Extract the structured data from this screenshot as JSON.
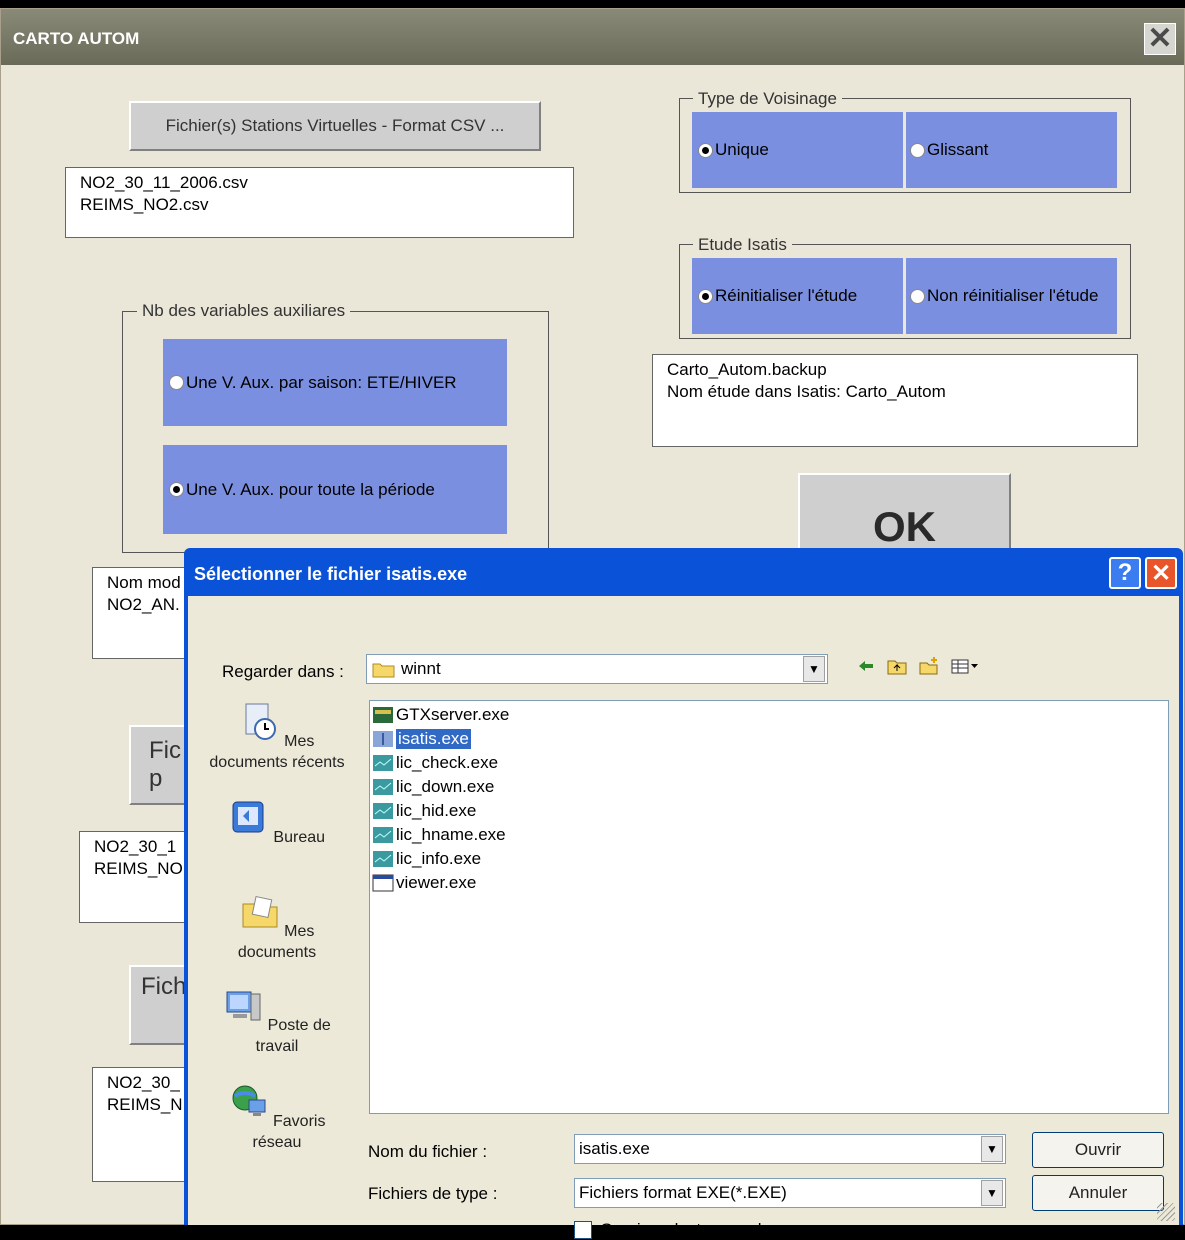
{
  "window": {
    "title": "CARTO AUTOM",
    "close_glyph": "✕"
  },
  "main": {
    "csv_button": "Fichier(s) Stations Virtuelles - Format CSV ...",
    "csv_files": "NO2_30_11_2006.csv\nREIMS_NO2.csv",
    "aux_group": {
      "legend": "Nb des variables auxiliares",
      "options": [
        {
          "label": "Une V. Aux. par saison: ETE/HIVER",
          "checked": false
        },
        {
          "label": "Une V. Aux. pour toute la période",
          "checked": true
        }
      ]
    },
    "model_box": "Nom mod\nNO2_AN.",
    "partial_button_1": "Fic\np",
    "partial_button_2": "Fich",
    "partial_list_1": "NO2_30_1\nREIMS_NO",
    "partial_list_2": "NO2_30_\nREIMS_N",
    "voisinage": {
      "legend": "Type de Voisinage",
      "options": [
        {
          "label": "Unique",
          "checked": true
        },
        {
          "label": "Glissant",
          "checked": false
        }
      ]
    },
    "isatis": {
      "legend": "Etude Isatis",
      "options": [
        {
          "label": "Réinitialiser l'étude",
          "checked": true
        },
        {
          "label": "Non réinitialiser l'étude",
          "checked": false
        }
      ]
    },
    "backup_box": "Carto_Autom.backup\nNom étude dans Isatis: Carto_Autom",
    "ok_label": "OK"
  },
  "dialog": {
    "title": "Sélectionner le fichier isatis.exe",
    "help_glyph": "?",
    "close_glyph": "✕",
    "look_in_label": "Regarder dans :",
    "look_in_value": "winnt",
    "toolbar_icons": [
      "back-arrow-icon",
      "up-folder-icon",
      "new-folder-icon",
      "view-menu-icon"
    ],
    "places": [
      {
        "label": "Mes documents récents",
        "icon": "recent-documents-icon"
      },
      {
        "label": "Bureau",
        "icon": "desktop-icon"
      },
      {
        "label": "Mes documents",
        "icon": "my-documents-icon"
      },
      {
        "label": "Poste de travail",
        "icon": "my-computer-icon"
      },
      {
        "label": "Favoris réseau",
        "icon": "network-places-icon"
      }
    ],
    "files": [
      {
        "name": "GTXserver.exe",
        "selected": false
      },
      {
        "name": "isatis.exe",
        "selected": true
      },
      {
        "name": "lic_check.exe",
        "selected": false
      },
      {
        "name": "lic_down.exe",
        "selected": false
      },
      {
        "name": "lic_hid.exe",
        "selected": false
      },
      {
        "name": "lic_hname.exe",
        "selected": false
      },
      {
        "name": "lic_info.exe",
        "selected": false
      },
      {
        "name": "viewer.exe",
        "selected": false
      }
    ],
    "filename_label": "Nom du fichier :",
    "filename_value": "isatis.exe",
    "filetype_label": "Fichiers de type :",
    "filetype_value": "Fichiers format EXE(*.EXE)",
    "readonly_label": "Ouvrir en lecture seule",
    "open_button": "Ouvrir",
    "cancel_button": "Annuler"
  },
  "colors": {
    "titlebar": "#7a7a68",
    "window_bg": "#eae6d8",
    "option_blue": "#7b8fe0",
    "dialog_blue": "#0a52d8",
    "selection": "#316ac5"
  }
}
